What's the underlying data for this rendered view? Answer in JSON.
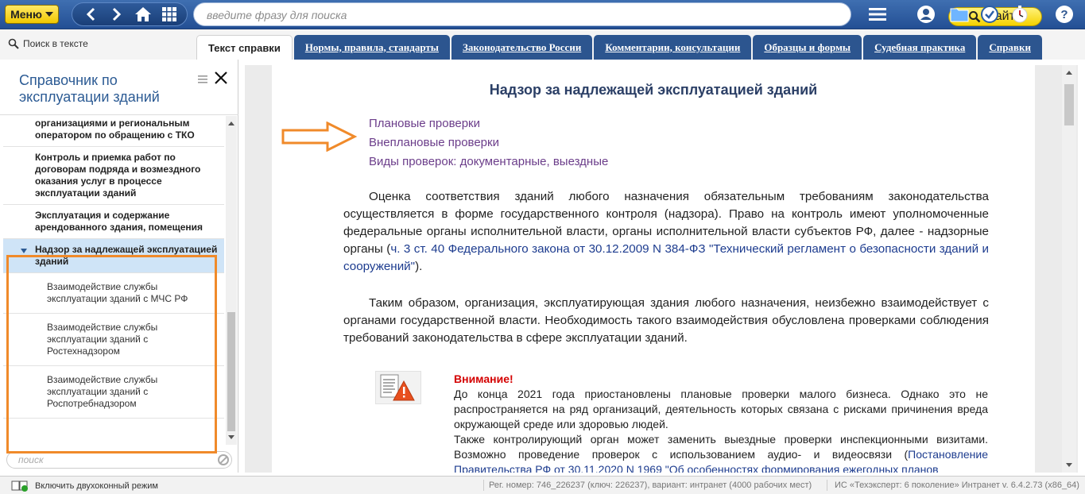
{
  "toolbar": {
    "menu_label": "Меню",
    "search_placeholder": "введите фразу для поиска",
    "find_label": "Найти"
  },
  "subrow": {
    "search_in_text": "Поиск в тексте"
  },
  "tabs": [
    {
      "label": "Текст справки",
      "active": true
    },
    {
      "label": "Нормы, правила, стандарты"
    },
    {
      "label": "Законодательство России"
    },
    {
      "label": "Комментарии, консультации"
    },
    {
      "label": "Образцы и формы"
    },
    {
      "label": "Судебная практика"
    },
    {
      "label": "Справки"
    }
  ],
  "sidebar": {
    "title": "Справочник по эксплуатации зданий",
    "items": [
      {
        "label": "организациями и региональным оператором по обращению с ТКО"
      },
      {
        "label": "Контроль и приемка работ по договорам подряда и возмездного оказания услуг в процессе эксплуатации зданий"
      },
      {
        "label": "Эксплуатация и содержание арендованного здания, помещения"
      },
      {
        "label": "Надзор за надлежащей эксплуатацией зданий"
      },
      {
        "label": "Взаимодействие службы эксплуатации зданий с МЧС РФ"
      },
      {
        "label": "Взаимодействие службы эксплуатации зданий с Ростехнадзором"
      },
      {
        "label": "Взаимодействие службы эксплуатации зданий с Роспотребнадзором"
      }
    ],
    "search_placeholder": "поиск"
  },
  "document": {
    "title": "Надзор за надлежащей эксплуатацией зданий",
    "toc": [
      "Плановые проверки",
      "Внеплановые проверки",
      "Виды проверок: документарные, выездные"
    ],
    "p1_text": "Оценка соответствия зданий любого назначения обязательным требованиям законодательства осуществляется в форме государственного контроля (надзора). Право на контроль имеют уполномоченные федеральные органы исполнительной власти, органы исполнительной власти субъектов РФ, далее - надзорные органы (",
    "p1_link": "ч. 3 ст. 40 Федерального закона от 30.12.2009 N 384-ФЗ \"Технический регламент о безопасности зданий и сооружений\"",
    "p1_end": ").",
    "p2_text": "Таким образом, организация, эксплуатирующая здания любого назначения, неизбежно взаимодействует с органами государственной власти. Необходимость такого взаимодействия обусловлена проверками соблюдения требований законодательства в сфере эксплуатации зданий.",
    "warning_title": "Внимание!",
    "warning_text1": "До конца 2021 года приостановлены плановые проверки малого бизнеса. Однако это не распространяется на ряд организаций, деятельность которых связана с рисками причинения вреда окружающей среде или здоровью людей.",
    "warning_text2": "Также контролирующий орган может заменить выездные проверки инспекционными визитами. Возможно проведение проверок с использованием аудио- и видеосвязи (",
    "warning_link": "Постановление Правительства РФ от 30.11.2020 N 1969 \"Об особенностях формирования ежегодных планов"
  },
  "statusbar": {
    "two_window": "Включить двухоконный режим",
    "reg": "Рег. номер: 746_226237 (ключ: 226237), вариант: интранет (4000 рабочих мест)",
    "version": "ИС «Техэксперт: 6 поколение» Интранет v. 6.4.2.73 (x86_64)"
  },
  "colors": {
    "toolbar": "#2c558f",
    "accent_yellow": "#f5d200",
    "highlight_orange": "#f08a2a",
    "link": "#1d3c8f",
    "toc_link": "#6b3d8a",
    "warning": "#d40000"
  }
}
